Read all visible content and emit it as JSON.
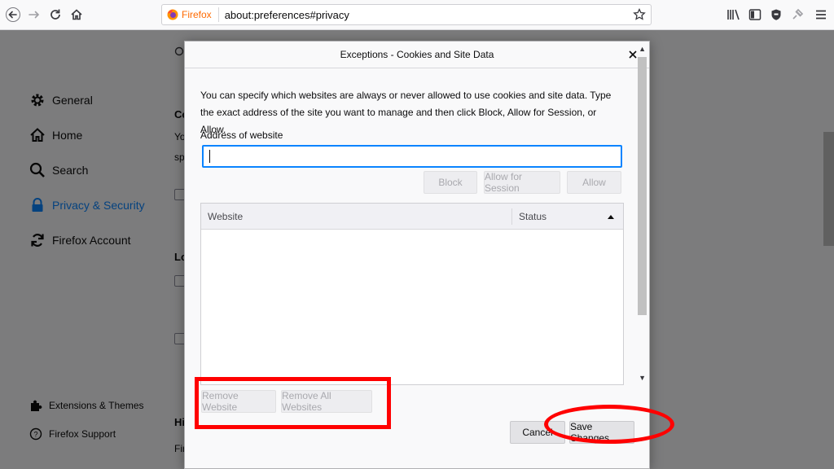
{
  "toolbar": {
    "back_icon": "back-arrow-icon",
    "forward_icon": "forward-arrow-icon",
    "reload_icon": "reload-icon",
    "home_icon": "home-icon",
    "identity_label": "Firefox",
    "url": "about:preferences#privacy",
    "bookmark_icon": "star-icon",
    "library_icon": "library-icon",
    "sidebar_icon": "sidebar-icon",
    "shield_icon": "shield-icon",
    "extension_icon": "extension-icon",
    "menu_icon": "hamburger-menu-icon"
  },
  "sidebar": {
    "items": [
      {
        "label": "General",
        "icon": "gear-icon"
      },
      {
        "label": "Home",
        "icon": "home-icon"
      },
      {
        "label": "Search",
        "icon": "search-icon"
      },
      {
        "label": "Privacy & Security",
        "icon": "lock-icon",
        "active": true
      },
      {
        "label": "Firefox Account",
        "icon": "sync-icon"
      }
    ],
    "footer": [
      {
        "label": "Extensions & Themes",
        "icon": "puzzle-icon"
      },
      {
        "label": "Firefox Support",
        "icon": "help-icon"
      }
    ]
  },
  "background": {
    "fragments": [
      "Co",
      "Yo",
      "sp",
      "Lo",
      "Hi",
      "Fir"
    ]
  },
  "dialog": {
    "title": "Exceptions - Cookies and Site Data",
    "description": "You can specify which websites are always or never allowed to use cookies and site data. Type the exact address of the site you want to manage and then click Block, Allow for Session, or Allow.",
    "address_label": "Address of website",
    "address_value": "",
    "block_label": "Block",
    "allow_session_label": "Allow for Session",
    "allow_label": "Allow",
    "columns": {
      "website": "Website",
      "status": "Status"
    },
    "remove_website_label": "Remove Website",
    "remove_all_label": "Remove All Websites",
    "cancel_label": "Cancel",
    "save_label": "Save Changes"
  },
  "colors": {
    "accent": "#0a84ff",
    "annotation": "#ff0000",
    "identity": "#ff6a00"
  }
}
